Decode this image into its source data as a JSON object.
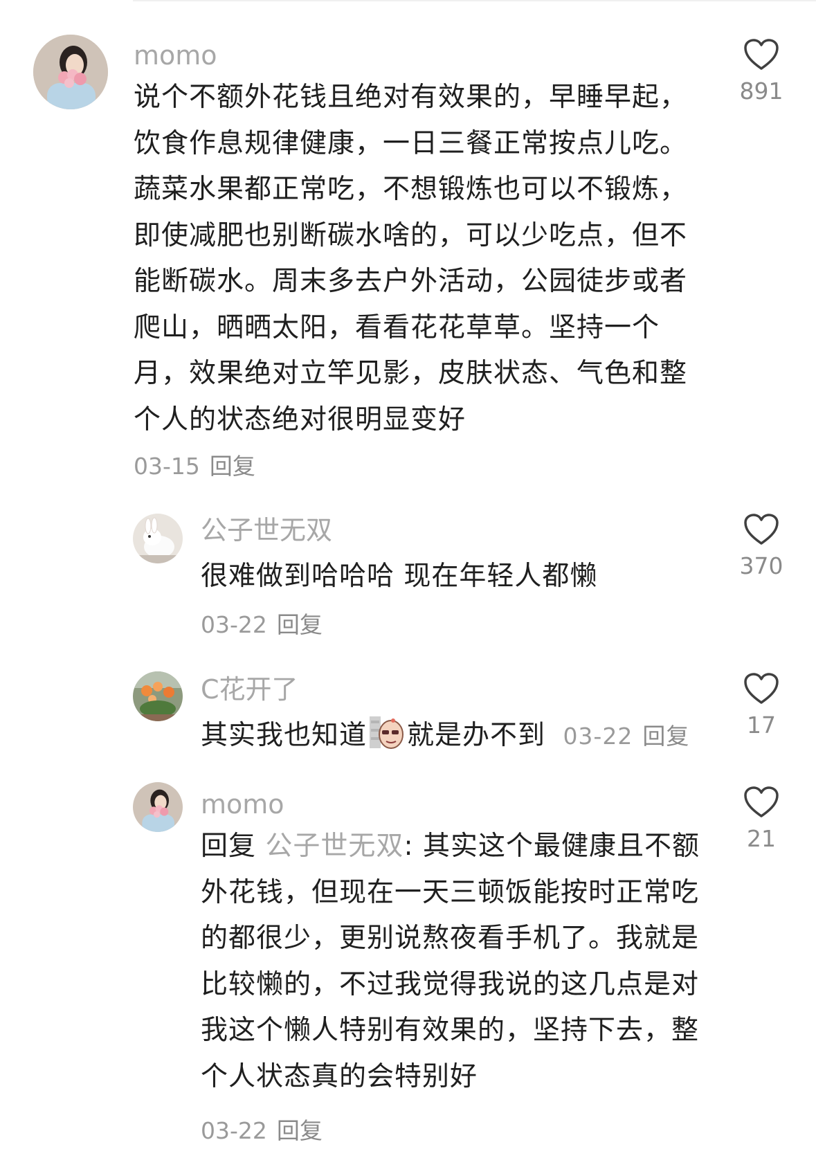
{
  "comments": [
    {
      "username": "momo",
      "text": "说个不额外花钱且绝对有效果的，早睡早起，饮食作息规律健康，一日三餐正常按点儿吃。蔬菜水果都正常吃，不想锻炼也可以不锻炼，即使减肥也别断碳水啥的，可以少吃点，但不能断碳水。周末多去户外活动，公园徒步或者爬山，晒晒太阳，看看花花草草。坚持一个月，效果绝对立竿见影，皮肤状态、气色和整个人的状态绝对很明显变好",
      "date": "03-15",
      "reply_label": "回复",
      "likes": "891",
      "avatar_icon": "avatar-woman-with-flowers"
    },
    {
      "username": "公子世无双",
      "text": "很难做到哈哈哈 现在年轻人都懒",
      "date": "03-22",
      "reply_label": "回复",
      "likes": "370",
      "avatar_icon": "avatar-white-rabbit"
    },
    {
      "username": "C花开了",
      "text_before": "其实我也知道",
      "sticker_icon": "peanut-emoji-sticker",
      "text_after": "就是办不到",
      "date": "03-22",
      "reply_label": "回复",
      "likes": "17",
      "avatar_icon": "avatar-flowers"
    },
    {
      "username": "momo",
      "reply_prefix": "回复",
      "mention": "公子世无双",
      "mention_sep": ":",
      "text": "其实这个最健康且不额外花钱，但现在一天三顿饭能按时正常吃的都很少，更别说熬夜看手机了。我就是比较懒的，不过我觉得我说的这几点是对我这个懒人特别有效果的，坚持下去，整个人状态真的会特别好",
      "date": "03-22",
      "reply_label": "回复",
      "likes": "21",
      "avatar_icon": "avatar-woman-with-flowers"
    }
  ],
  "colors": {
    "text": "#1f1f1f",
    "username": "#a7a7a7",
    "meta": "#9a9a9a"
  }
}
